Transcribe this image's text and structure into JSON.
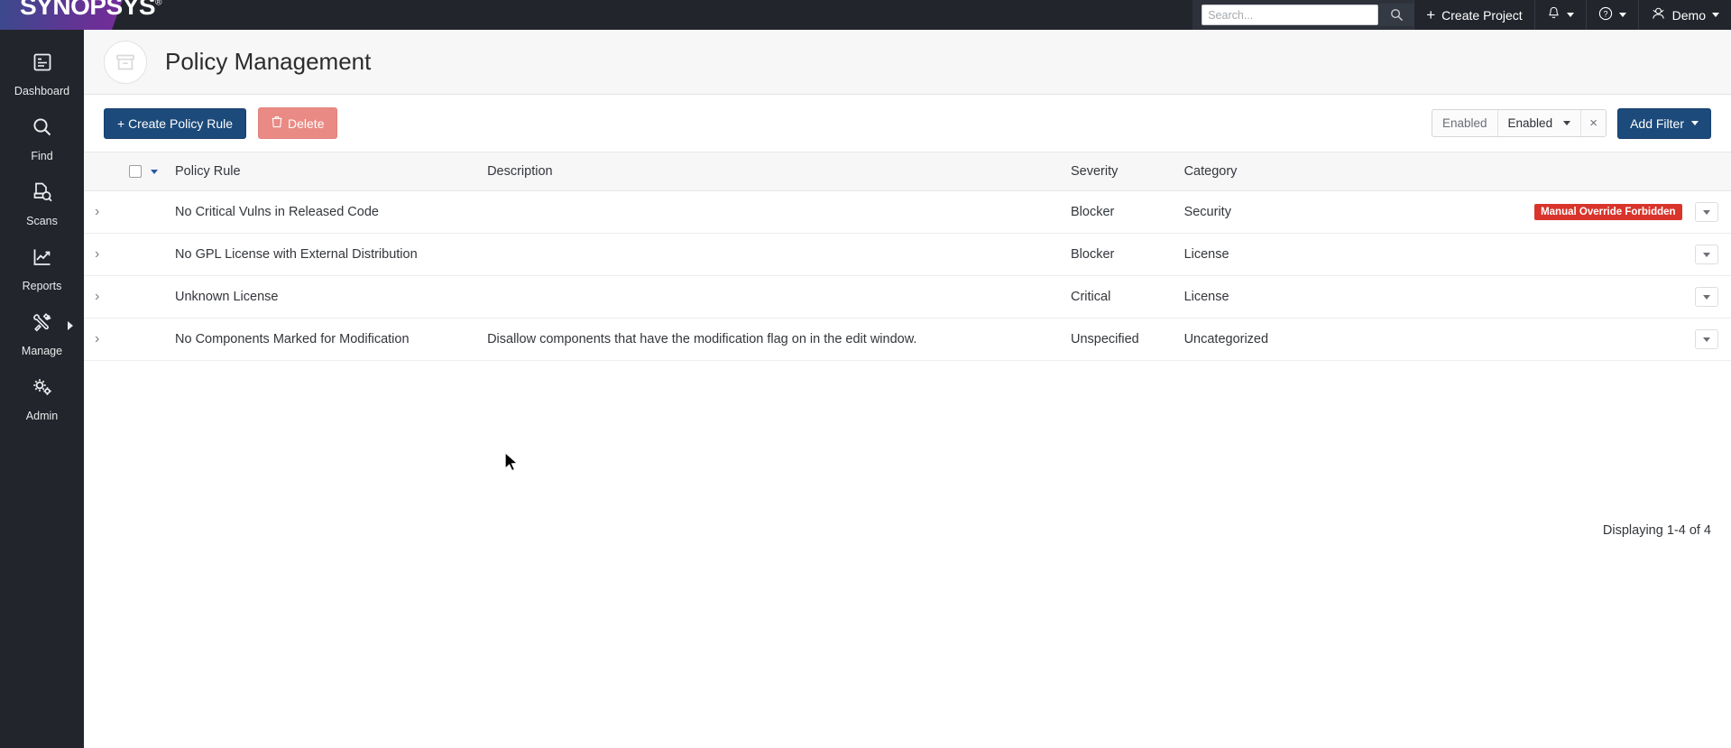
{
  "brand": {
    "logo": "SYNOPSYS",
    "logo_mark": "®"
  },
  "topbar": {
    "search": {
      "placeholder": "Search...",
      "value": "",
      "icon": "search-icon"
    },
    "create_project": {
      "label": "Create Project",
      "plus": "+"
    },
    "notifications": {
      "icon": "bell-icon"
    },
    "help": {
      "icon": "question-circle-icon"
    },
    "user": {
      "label": "Demo",
      "icon": "user-icon"
    }
  },
  "sidebar": {
    "items": [
      {
        "label": "Dashboard",
        "icon": "dashboard-icon",
        "has_flyout": false
      },
      {
        "label": "Find",
        "icon": "search-icon",
        "has_flyout": false
      },
      {
        "label": "Scans",
        "icon": "scan-document-icon",
        "has_flyout": false
      },
      {
        "label": "Reports",
        "icon": "chart-line-icon",
        "has_flyout": false
      },
      {
        "label": "Manage",
        "icon": "tools-icon",
        "has_flyout": true
      },
      {
        "label": "Admin",
        "icon": "gears-icon",
        "has_flyout": false
      }
    ]
  },
  "page": {
    "title": "Policy Management",
    "icon": "archive-box-icon"
  },
  "toolbar": {
    "create_rule_label": "+ Create Policy Rule",
    "delete_label": "Delete",
    "delete_icon": "trash-icon",
    "filter_chip": {
      "key": "Enabled",
      "value": "Enabled",
      "remove": "×"
    },
    "add_filter_label": "Add Filter"
  },
  "table": {
    "columns": [
      "Policy Rule",
      "Description",
      "Severity",
      "Category"
    ],
    "rows": [
      {
        "name": "No Critical Vulns in Released Code",
        "description": "",
        "severity": "Blocker",
        "category": "Security",
        "badge": "Manual Override Forbidden"
      },
      {
        "name": "No GPL License with External Distribution",
        "description": "",
        "severity": "Blocker",
        "category": "License",
        "badge": ""
      },
      {
        "name": "Unknown License",
        "description": "",
        "severity": "Critical",
        "category": "License",
        "badge": ""
      },
      {
        "name": "No Components Marked for Modification",
        "description": "Disallow components that have the modification flag on in the edit window.",
        "severity": "Unspecified",
        "category": "Uncategorized",
        "badge": ""
      }
    ]
  },
  "footer": {
    "count_text": "Displaying 1-4 of 4"
  },
  "colors": {
    "header_bg": "#22252c",
    "primary_button": "#1c4a7a",
    "danger_button": "#e98a84",
    "badge_red": "#d9342b",
    "brand_purple": "#7b2d9e"
  }
}
